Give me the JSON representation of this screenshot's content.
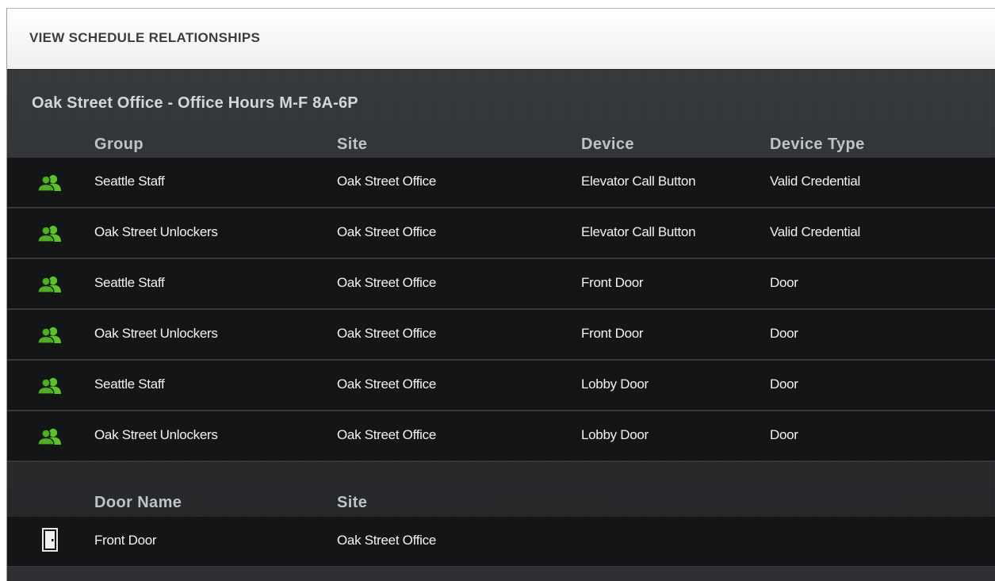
{
  "header": {
    "title": "VIEW SCHEDULE RELATIONSHIPS"
  },
  "schedule": {
    "title": "Oak Street Office - Office Hours M-F 8A-6P",
    "columns": [
      "Group",
      "Site",
      "Device",
      "Device Type"
    ],
    "rows": [
      {
        "icon": "group-icon",
        "group": "Seattle Staff",
        "site": "Oak Street Office",
        "device": "Elevator Call Button",
        "device_type": "Valid Credential"
      },
      {
        "icon": "group-icon",
        "group": "Oak Street Unlockers",
        "site": "Oak Street Office",
        "device": "Elevator Call Button",
        "device_type": "Valid Credential"
      },
      {
        "icon": "group-icon",
        "group": "Seattle Staff",
        "site": "Oak Street Office",
        "device": "Front Door",
        "device_type": "Door"
      },
      {
        "icon": "group-icon",
        "group": "Oak Street Unlockers",
        "site": "Oak Street Office",
        "device": "Front Door",
        "device_type": "Door"
      },
      {
        "icon": "group-icon",
        "group": "Seattle Staff",
        "site": "Oak Street Office",
        "device": "Lobby Door",
        "device_type": "Door"
      },
      {
        "icon": "group-icon",
        "group": "Oak Street Unlockers",
        "site": "Oak Street Office",
        "device": "Lobby Door",
        "device_type": "Door"
      }
    ]
  },
  "doors": {
    "columns": [
      "Door Name",
      "Site"
    ],
    "rows": [
      {
        "icon": "door-icon",
        "name": "Front Door",
        "site": "Oak Street Office"
      }
    ]
  },
  "colors": {
    "group_icon": "#5cc229",
    "row_background": "#141517",
    "header_text": "#3a3d44"
  }
}
